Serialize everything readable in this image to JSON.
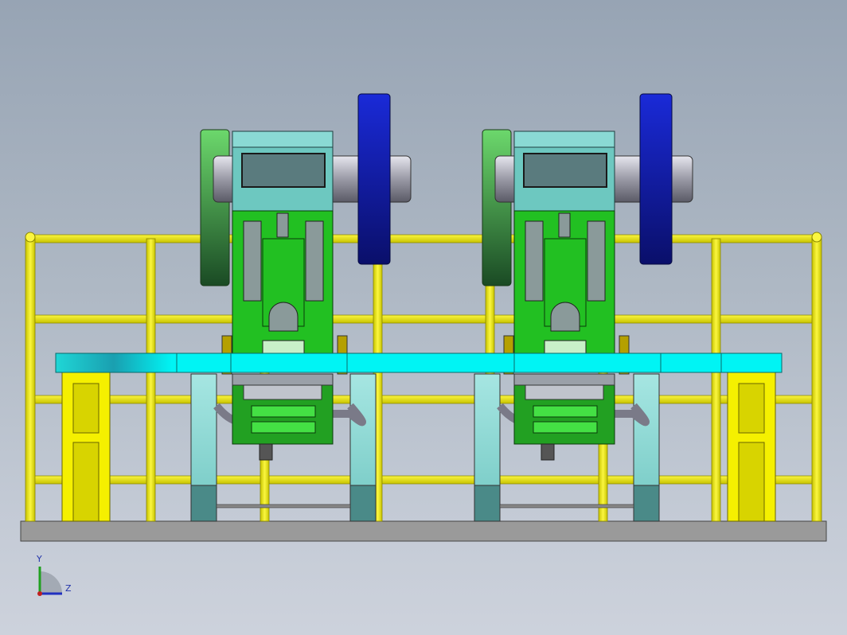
{
  "view": {
    "background_top": "#97a4b4",
    "background_bottom": "#cdd2dc"
  },
  "colors": {
    "railing": "#f5f000",
    "table_top": "#00f5f5",
    "press_frame": "#22c022",
    "press_head": "#6dc8c0",
    "flywheel_blue": "#1820c8",
    "flywheel_green": "#5ec45e",
    "legs": "#8ad8d4",
    "base": "#9a9a9a"
  },
  "objects": [
    "railing",
    "work-table",
    "press-left",
    "press-right",
    "flywheel-left",
    "flywheel-right",
    "base-plate"
  ],
  "triad": {
    "y_label": "Y",
    "z_label": "Z"
  }
}
